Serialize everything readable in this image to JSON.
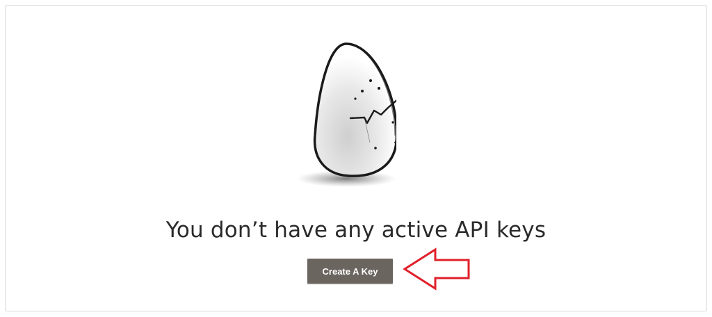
{
  "empty_state": {
    "title": "You don’t have any active API keys",
    "illustration": "cracked-egg-icon"
  },
  "actions": {
    "create_key_label": "Create A Key"
  },
  "annotation": {
    "icon": "arrow-left-icon",
    "color": "#e0202a"
  },
  "colors": {
    "button_bg": "#6b6560",
    "title_text": "#2a2a2a",
    "panel_border": "#d9d9d9"
  }
}
